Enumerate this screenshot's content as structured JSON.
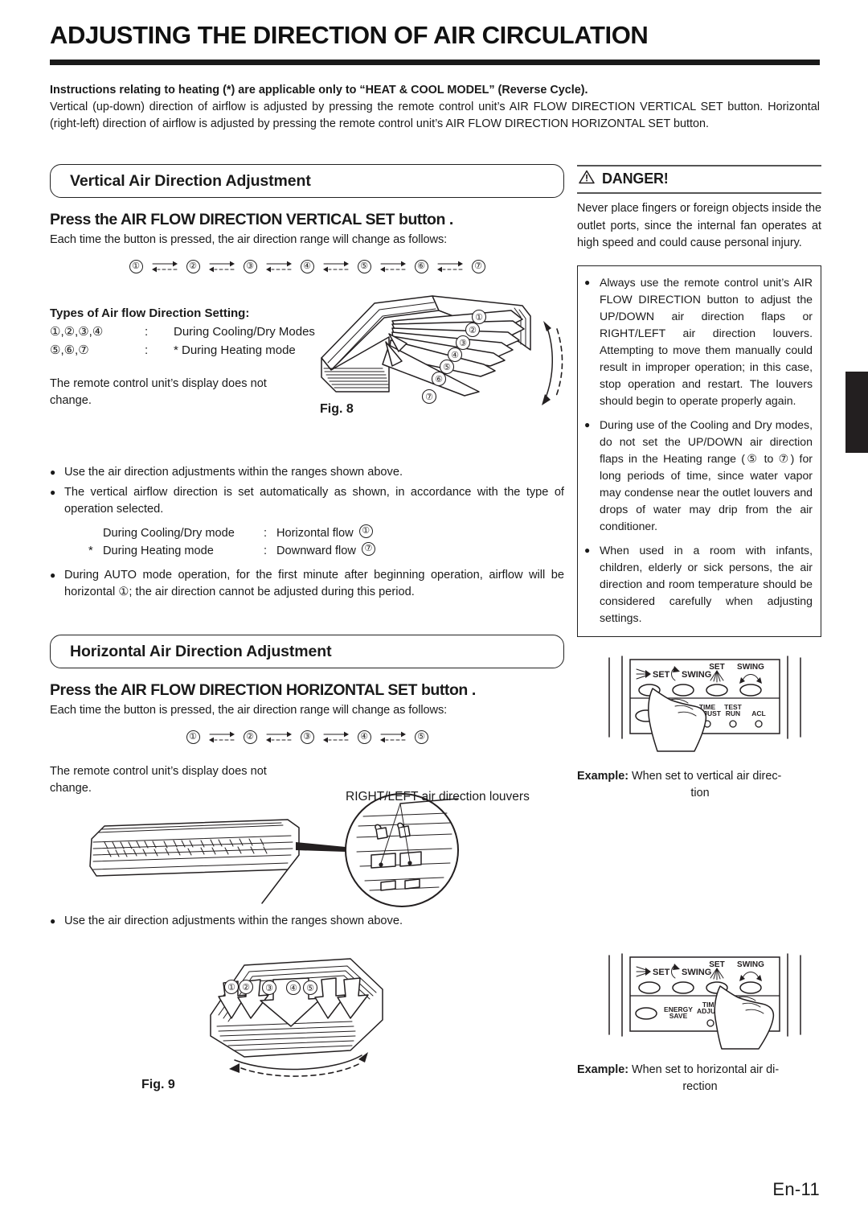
{
  "page": {
    "title": "ADJUSTING THE DIRECTION OF AIR CIRCULATION",
    "footer": "En-11"
  },
  "intro": {
    "lead": "Instructions relating to heating (*) are applicable only to “HEAT & COOL MODEL” (Reverse Cycle).",
    "body": "Vertical (up-down) direction of airflow is adjusted by pressing the remote control unit’s AIR FLOW DIRECTION VERTICAL SET button. Horizontal (right-left) direction of airflow is adjusted by pressing the remote control unit’s AIR FLOW DIRECTION HORIZONTAL SET button."
  },
  "vertical": {
    "section_heading": "Vertical Air Direction Adjustment",
    "press_heading": "Press the AIR FLOW DIRECTION VERTICAL SET button .",
    "sub_line": "Each time the button is pressed, the air direction range will change as follows:",
    "sequence": [
      "①",
      "②",
      "③",
      "④",
      "⑤",
      "⑥",
      "⑦"
    ],
    "types_title": "Types of Air flow Direction Setting:",
    "types_rows": [
      {
        "nums": "①,②,③,④",
        "colon": ":",
        "desc": "During Cooling/Dry Modes"
      },
      {
        "nums": "⑤,⑥,⑦",
        "colon": ":",
        "desc": "* During Heating mode"
      }
    ],
    "display_note": "The remote control unit’s display does not change.",
    "fig_caption": "Fig. 8",
    "fig_labels": [
      "①",
      "②",
      "③",
      "④",
      "⑤",
      "⑥",
      "⑦"
    ],
    "bullets": [
      "Use the air direction adjustments within the ranges shown above.",
      "The vertical airflow direction is set automatically as shown, in accordance with the type of operation selected."
    ],
    "mode_rows": [
      {
        "star": "",
        "label": "During Cooling/Dry mode",
        "colon": ":",
        "value": "Horizontal flow",
        "num": "①"
      },
      {
        "star": "*",
        "label": "During Heating mode",
        "colon": ":",
        "value": "Downward flow",
        "num": "⑦"
      }
    ],
    "auto_bullet": "During AUTO mode operation, for the first minute after beginning operation, airflow will be horizontal ①; the air direction cannot be adjusted during this period."
  },
  "horizontal": {
    "section_heading": "Horizontal Air Direction Adjustment",
    "press_heading": "Press the AIR FLOW DIRECTION HORIZONTAL SET button .",
    "sub_line": "Each time the button is pressed, the air direction range will change as follows:",
    "sequence": [
      "①",
      "②",
      "③",
      "④",
      "⑤"
    ],
    "display_note": "The remote control unit’s display does not change.",
    "callout_label": "RIGHT/LEFT air direction louvers",
    "bullet": "Use the air direction adjustments within the ranges shown above.",
    "fig_caption": "Fig. 9",
    "fig_labels": [
      "①",
      "②",
      "③",
      "④",
      "⑤"
    ]
  },
  "danger": {
    "icon": "warning-triangle-icon",
    "title": "DANGER!",
    "body": "Never place fingers or foreign objects inside the outlet ports, since the internal fan operates at high speed and could cause personal injury.",
    "notes": [
      "Always use the remote control unit’s AIR FLOW DIRECTION button to adjust the UP/DOWN air direction flaps or RIGHT/LEFT air direction louvers. Attempting to move them manually could result in improper operation; in this case, stop operation and restart. The louvers should begin to operate properly again.",
      "During use of the Cooling and Dry modes, do not set the UP/DOWN air direction flaps in the Heating range (⑤ to ⑦) for long periods of time, since water vapor may condense near the outlet louvers and drops of water may drip from the air conditioner.",
      "When used in a room with infants, children, elderly or sick persons, the air direction and room temperature should be considered carefully when adjusting settings."
    ]
  },
  "remote_vertical": {
    "buttons_row1": [
      "SET",
      "SWING",
      "SET",
      "SWING"
    ],
    "buttons_row2": [
      "TIME ADJUST",
      "TEST RUN",
      "ACL"
    ],
    "example_label": "Example:",
    "example_text": "When set to vertical air direc-",
    "example_text2": "tion"
  },
  "remote_horizontal": {
    "buttons_row1": [
      "SET",
      "SWING",
      "SET",
      "SWING"
    ],
    "buttons_row2": [
      "ENERGY SAVE",
      "TIME ADJUST"
    ],
    "example_label": "Example:",
    "example_text": "When set to horizontal air di-",
    "example_text2": "rection"
  },
  "colors": {
    "ink": "#231f20",
    "paper": "#ffffff",
    "tab": "#231f20"
  }
}
